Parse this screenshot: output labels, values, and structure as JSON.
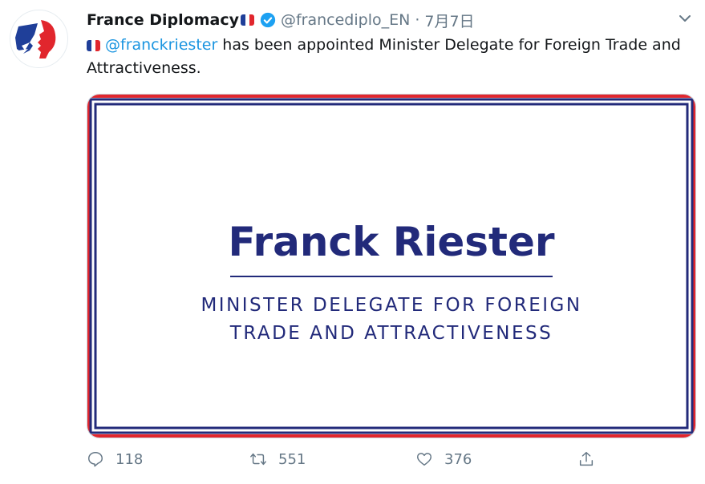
{
  "tweet": {
    "author_name": "France Diplomacy",
    "handle": "@francediplo_EN",
    "separator": "·",
    "date": "7月7日",
    "mention": "@franckriester",
    "text_after_mention": " has been appointed Minister Delegate for Foreign Trade and Attractiveness.",
    "card": {
      "title": "Franck Riester",
      "subtitle_line1": "MINISTER DELEGATE FOR FOREIGN",
      "subtitle_line2": "TRADE AND ATTRACTIVENESS"
    },
    "actions": {
      "replies": "118",
      "retweets": "551",
      "likes": "376"
    }
  },
  "colors": {
    "flag_blue": "#1f3f99",
    "flag_white": "#ffffff",
    "flag_red": "#e1262d",
    "link": "#1b95e0",
    "card_navy": "#222a7a",
    "muted": "#657786"
  },
  "icons": [
    "marianne-logo-icon",
    "france-flag-icon",
    "verified-badge-icon",
    "chevron-down-icon",
    "reply-icon",
    "retweet-icon",
    "like-icon",
    "share-icon"
  ]
}
